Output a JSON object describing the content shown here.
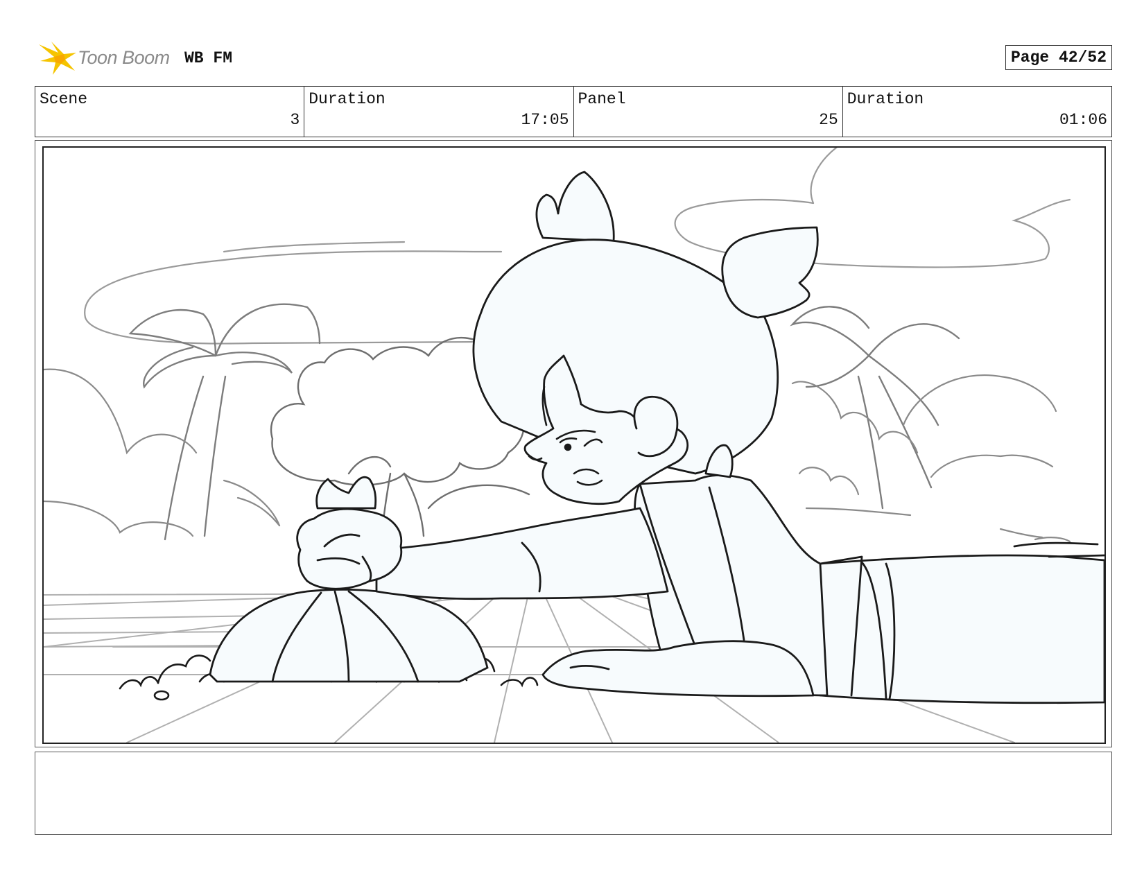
{
  "header": {
    "logo_text": "Toon Boom",
    "project": "WB FM",
    "page": "Page 42/52"
  },
  "info": {
    "scene_label": "Scene",
    "scene_value": "3",
    "scene_duration_label": "Duration",
    "scene_duration_value": "17:05",
    "panel_label": "Panel",
    "panel_value": "25",
    "panel_duration_label": "Duration",
    "panel_duration_value": "01:06"
  },
  "notes": {
    "text": ""
  },
  "colors": {
    "logo_star": "#f5c400",
    "logo_text": "#8a8a8a",
    "character_fill": "#f7fbfd",
    "sketch_gray": "#8c8c8c",
    "ink": "#1a1a1a"
  },
  "icons": {
    "logo": "toon-boom-star-icon"
  }
}
